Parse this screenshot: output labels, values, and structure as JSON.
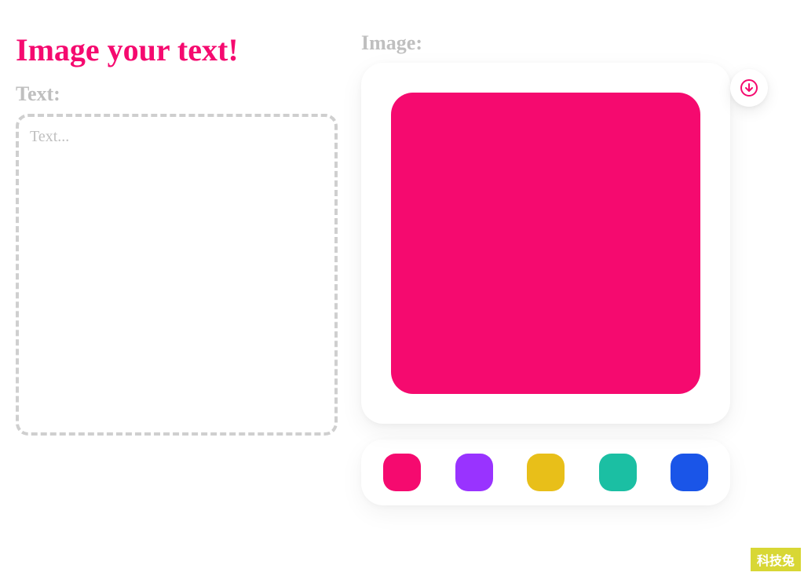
{
  "title": "Image your text!",
  "labels": {
    "text": "Text:",
    "image": "Image:"
  },
  "text_input": {
    "placeholder": "Text...",
    "value": ""
  },
  "preview": {
    "color": "#f50a6f"
  },
  "download_icon_color": "#f50a6f",
  "palette": [
    "#f50a6f",
    "#9933ff",
    "#e8bf19",
    "#1bbfa3",
    "#1a55e8"
  ],
  "watermark": "科技兔"
}
